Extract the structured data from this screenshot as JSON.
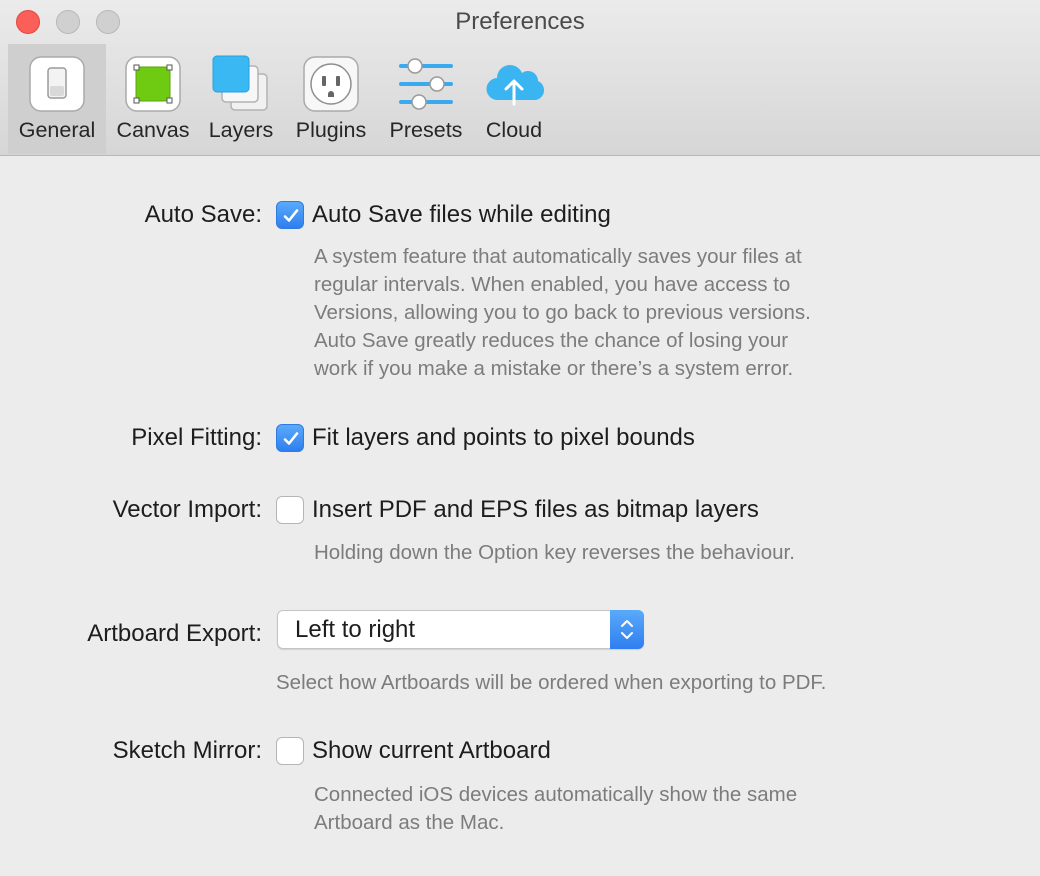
{
  "window": {
    "title": "Preferences"
  },
  "toolbar": {
    "tabs": [
      {
        "label": "General",
        "icon": "general-switch-icon",
        "selected": true
      },
      {
        "label": "Canvas",
        "icon": "canvas-icon",
        "selected": false
      },
      {
        "label": "Layers",
        "icon": "layers-icon",
        "selected": false
      },
      {
        "label": "Plugins",
        "icon": "plugins-icon",
        "selected": false
      },
      {
        "label": "Presets",
        "icon": "presets-sliders-icon",
        "selected": false
      },
      {
        "label": "Cloud",
        "icon": "cloud-upload-icon",
        "selected": false
      }
    ]
  },
  "settings": {
    "auto_save": {
      "label": "Auto Save:",
      "checked": true,
      "option": "Auto Save files while editing",
      "description": [
        "A system feature that automatically saves your files at",
        "regular intervals. When enabled, you have access to",
        "Versions, allowing you to go back to previous versions.",
        "Auto Save greatly reduces the chance of losing your",
        "work if you make a mistake or there’s a system error."
      ]
    },
    "pixel_fitting": {
      "label": "Pixel Fitting:",
      "checked": true,
      "option": "Fit layers and points to pixel bounds"
    },
    "vector_import": {
      "label": "Vector Import:",
      "checked": false,
      "option": "Insert PDF and EPS files as bitmap layers",
      "description": [
        "Holding down the Option key reverses the behaviour."
      ]
    },
    "artboard_export": {
      "label": "Artboard Export:",
      "selected": "Left to right",
      "description": "Select how Artboards will be ordered when exporting to PDF."
    },
    "sketch_mirror": {
      "label": "Sketch Mirror:",
      "checked": false,
      "option": "Show current Artboard",
      "description": [
        "Connected iOS devices automatically show the same",
        "Artboard as the Mac."
      ]
    }
  },
  "colors": {
    "accent": "#3b8cf5",
    "close_button": "#fc5f57",
    "canvas_green": "#7ed321"
  }
}
